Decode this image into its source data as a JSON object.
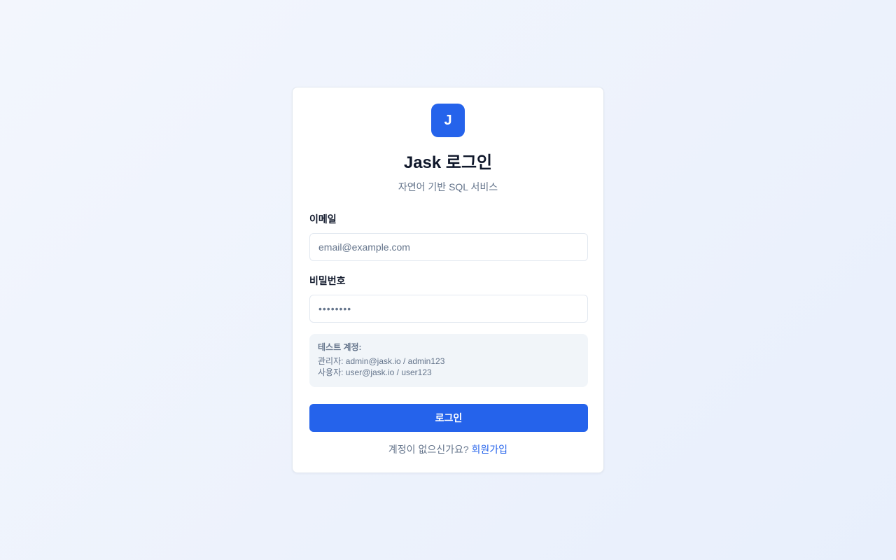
{
  "logo": {
    "letter": "J"
  },
  "header": {
    "title": "Jask 로그인",
    "subtitle": "자연어 기반 SQL 서비스"
  },
  "form": {
    "email": {
      "label": "이메일",
      "placeholder": "email@example.com",
      "value": ""
    },
    "password": {
      "label": "비밀번호",
      "placeholder": "••••••••",
      "value": ""
    },
    "test_accounts": {
      "title": "테스트 계정:",
      "admin": "관리자: admin@jask.io / admin123",
      "user": "사용자: user@jask.io / user123"
    },
    "submit_label": "로그인"
  },
  "footer": {
    "prompt": "계정이 없으신가요?",
    "signup_label": "회원가입"
  },
  "colors": {
    "primary": "#2563eb",
    "text": "#0f172a",
    "muted": "#64748b",
    "border": "#e2e8f0",
    "info_bg": "#f1f5f9"
  }
}
